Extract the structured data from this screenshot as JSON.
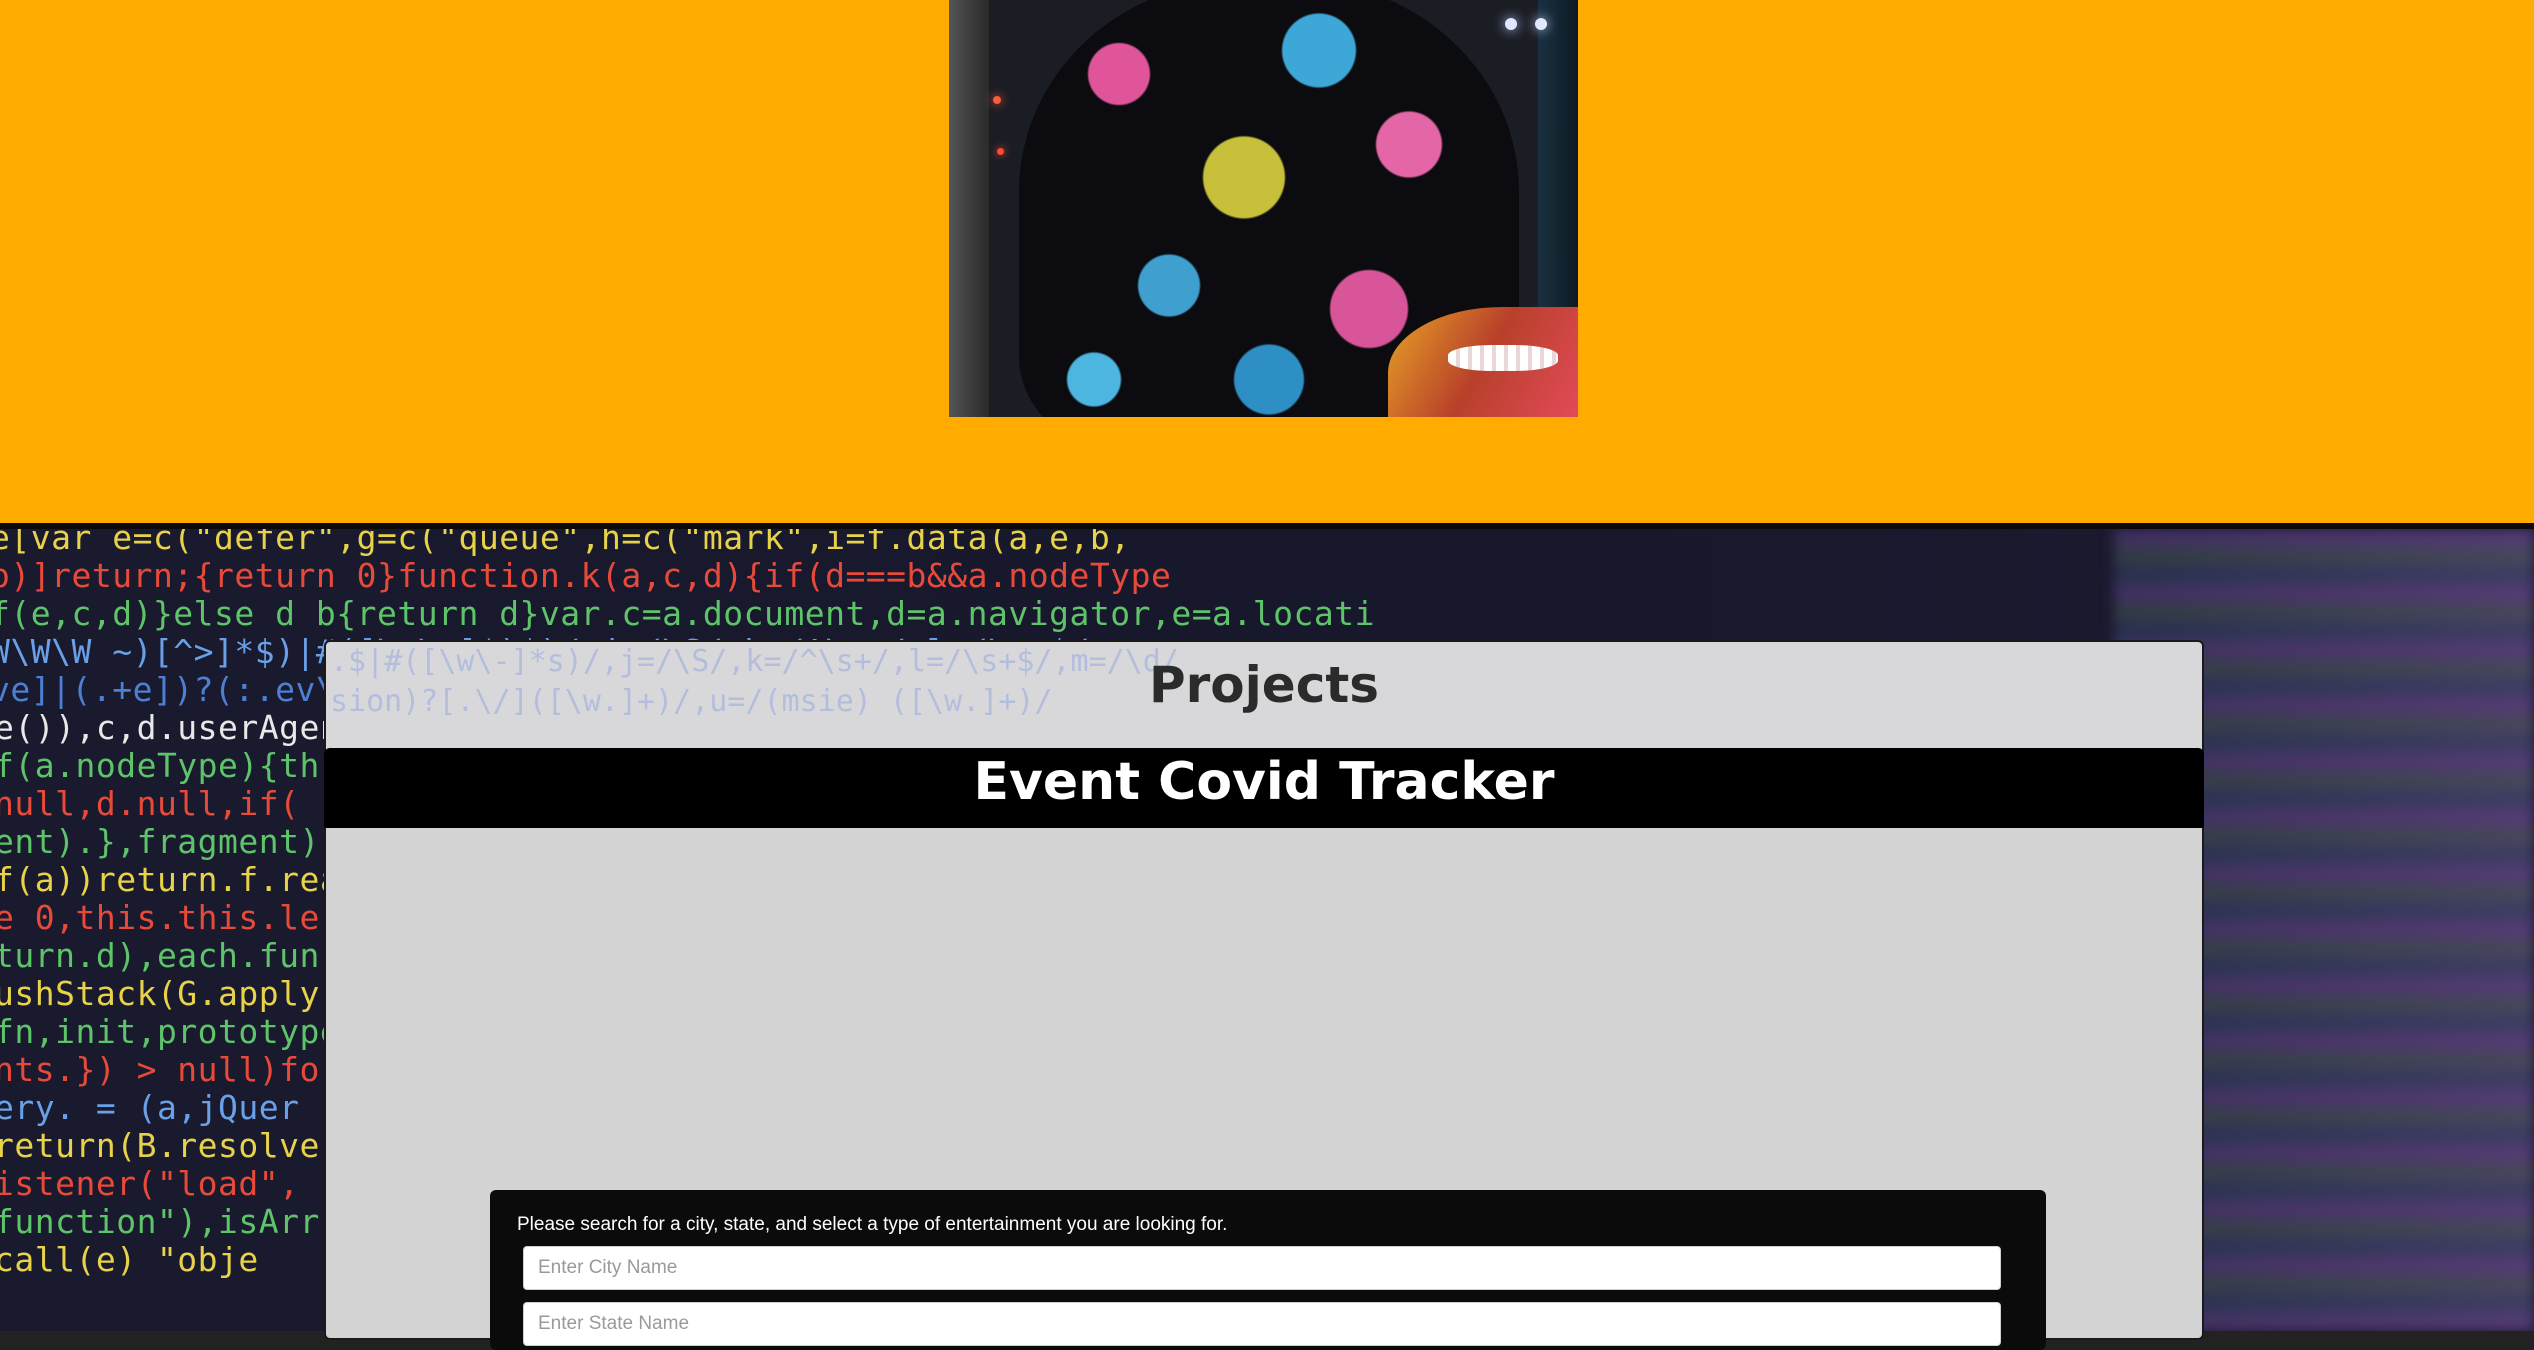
{
  "hero": {
    "background_color": "#ffab00",
    "photo_alt": "person in tie-dye hoodie"
  },
  "code_background": {
    "lines": [
      {
        "text": "e[var e=c(\"defer\",g=c(\"queue\",h=c(\"mark\",i=f.data(a,e,b,",
        "color": "#e8d24a"
      },
      {
        "text": "o)]return;{return 0}function.k(a,c,d){if(d===b&&a.nodeType",
        "color": "#e84a3a"
      },
      {
        "text": "f(e,c,d)}else d b{return d}var.c=a.document,d=a.navigator,e=a.locati",
        "color": "#5ec46a"
      },
      {
        "text": "  W\\W\\W  ~)[^>]*$)|#([\\w\\-]*)$)/,j=/\\S/,k=/^\\s+/,l=/\\s+$/",
        "color": "#6aa0e8"
      },
      {
        "text": "ve]|(.+e])?(:.ev\\sion)?[.\\/]([\\w.]+)/,u=/(msie) ([\\w.]+)/",
        "color": "#4d7fd4"
      },
      {
        "text": "e()),c,d.userAgent",
        "color": "#e8e8e8"
      },
      {
        "text": "f(a.nodeType){th",
        "color": "#5ec46a"
      },
      {
        "text": "null,d.null,if(",
        "color": "#e84a3a"
      },
      {
        "text": "ent).},fragment)",
        "color": "#5ec46a"
      },
      {
        "text": "f(a))return.f.rea",
        "color": "#e8d24a"
      },
      {
        "text": "e 0,this.this.le",
        "color": "#e84a3a"
      },
      {
        "text": "turn.d),each.fun",
        "color": "#5ec46a"
      },
      {
        "text": "ushStack(G.apply",
        "color": "#e8d24a"
      },
      {
        "text": "fn,init,prototype",
        "color": "#5ec46a"
      },
      {
        "text": "nts.}) > null)fo",
        "color": "#e84a3a"
      },
      {
        "text": "ery.  = (a,jQuer",
        "color": "#6aa0e8"
      },
      {
        "text": "return(B.resolve",
        "color": "#e8d24a"
      },
      {
        "text": "istener(\"load\",",
        "color": "#e84a3a"
      },
      {
        "text": "function\"),isArr",
        "color": "#5ec46a"
      },
      {
        "text": "call(e)  \"obje",
        "color": "#e8d24a"
      }
    ]
  },
  "projects": {
    "title": "Projects",
    "header_code": [
      ".$|#([\\w\\-]*s)/,j=/\\S/,k=/^\\s+/,l=/\\s+$/,m=/\\d/",
      "sion)?[.\\/]([\\w.]+)/,u=/(msie) ([\\w.]+)/"
    ],
    "current_project": {
      "title": "Event Covid Tracker",
      "search": {
        "instructions": "Please search for a city, state, and select a type of entertainment you are looking for.",
        "city_placeholder": "Enter City Name",
        "state_placeholder": "Enter State Name"
      }
    }
  }
}
